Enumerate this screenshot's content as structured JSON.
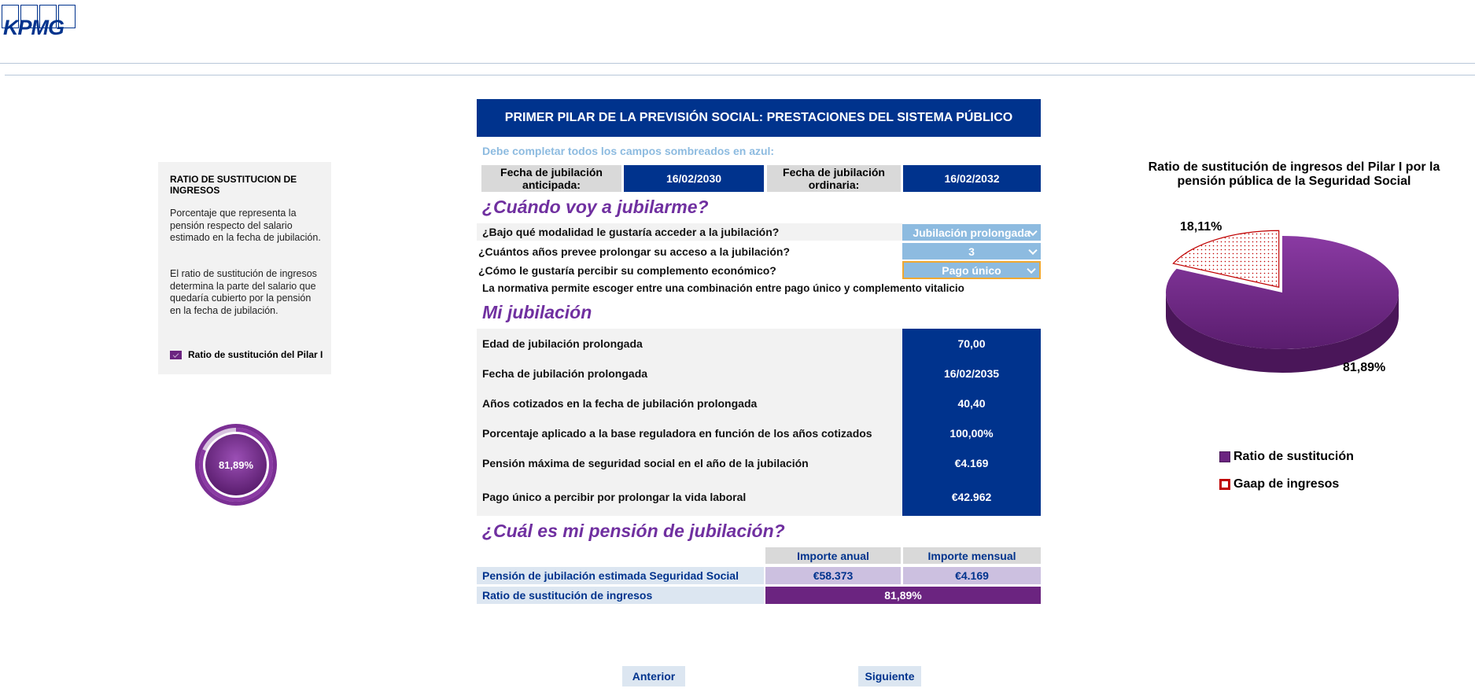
{
  "logo": {
    "text": "KPMG"
  },
  "info_panel": {
    "title": "RATIO DE SUSTITUCION DE INGRESOS",
    "paragraph1": "Porcentaje que representa la pensión respecto del salario estimado en la fecha de jubilación.",
    "paragraph2": "El ratio de sustitución de ingresos determina la parte del salario que quedaría cubierto por la pensión en la fecha de jubilación.",
    "legend": "Ratio de sustitución del Pilar I"
  },
  "donut": {
    "label": "81,89%",
    "value": 0.8189,
    "color": "#6b2480"
  },
  "main": {
    "title": "PRIMER PILAR DE LA PREVISIÓN SOCIAL: PRESTACIONES DEL SISTEMA PÚBLICO",
    "note": "Debe completar todos los campos sombreados en azul:",
    "dates": {
      "anticipada_label": "Fecha de jubilación anticipada:",
      "anticipada_value": "16/02/2030",
      "ordinaria_label": "Fecha de jubilación ordinaria:",
      "ordinaria_value": "16/02/2032"
    },
    "section1": "¿Cuándo voy a jubilarme?",
    "questions": [
      {
        "label": "¿Bajo qué modalidad le gustaría acceder a la jubilación?",
        "value": "Jubilación prolongada"
      },
      {
        "label": "¿Cuántos años prevee prolongar su acceso a la jubilación?",
        "value": "3"
      },
      {
        "label": "¿Cómo le gustaría percibir su complemento económico?",
        "value": "Pago único"
      }
    ],
    "normativa": "La normativa permite escoger entre una combinación entre pago único y complemento vitalicio",
    "section2": "Mi jubilación",
    "mi_jubilacion": [
      {
        "label": "Edad de jubilación prolongada",
        "value": "70,00"
      },
      {
        "label": "Fecha de jubilación prolongada",
        "value": "16/02/2035"
      },
      {
        "label": "Años cotizados en la fecha de jubilación prolongada",
        "value": "40,40"
      },
      {
        "label": "Porcentaje aplicado a la base reguladora en función de los años cotizados",
        "value": "100,00%"
      },
      {
        "label": "Pensión máxima de seguridad social en el año de la jubilación",
        "value": "€4.169"
      },
      {
        "label": "Pago único a percibir por prolongar la vida laboral",
        "value": "€42.962"
      }
    ],
    "section3": "¿Cuál es mi pensión de jubilación?",
    "pension_table": {
      "col_annual": "Importe anual",
      "col_monthly": "Importe mensual",
      "row1_label": "Pensión de jubilación estimada Seguridad Social",
      "row1_annual": "€58.373",
      "row1_monthly": "€4.169",
      "row2_label": "Ratio de sustitución de ingresos",
      "row2_value": "81,89%"
    },
    "buttons": {
      "prev": "Anterior",
      "next": "Siguiente"
    }
  },
  "chart_data": {
    "type": "pie",
    "title": "Ratio de sustitución de ingresos del Pilar I por la pensión pública de la Seguridad Social",
    "categories": [
      "Ratio de sustitución",
      "Gaap de ingresos"
    ],
    "values": [
      81.89,
      18.11
    ],
    "labels": [
      "81,89%",
      "18,11%"
    ],
    "colors": [
      "#6b2480",
      "#c00000"
    ],
    "legend_position": "bottom"
  }
}
